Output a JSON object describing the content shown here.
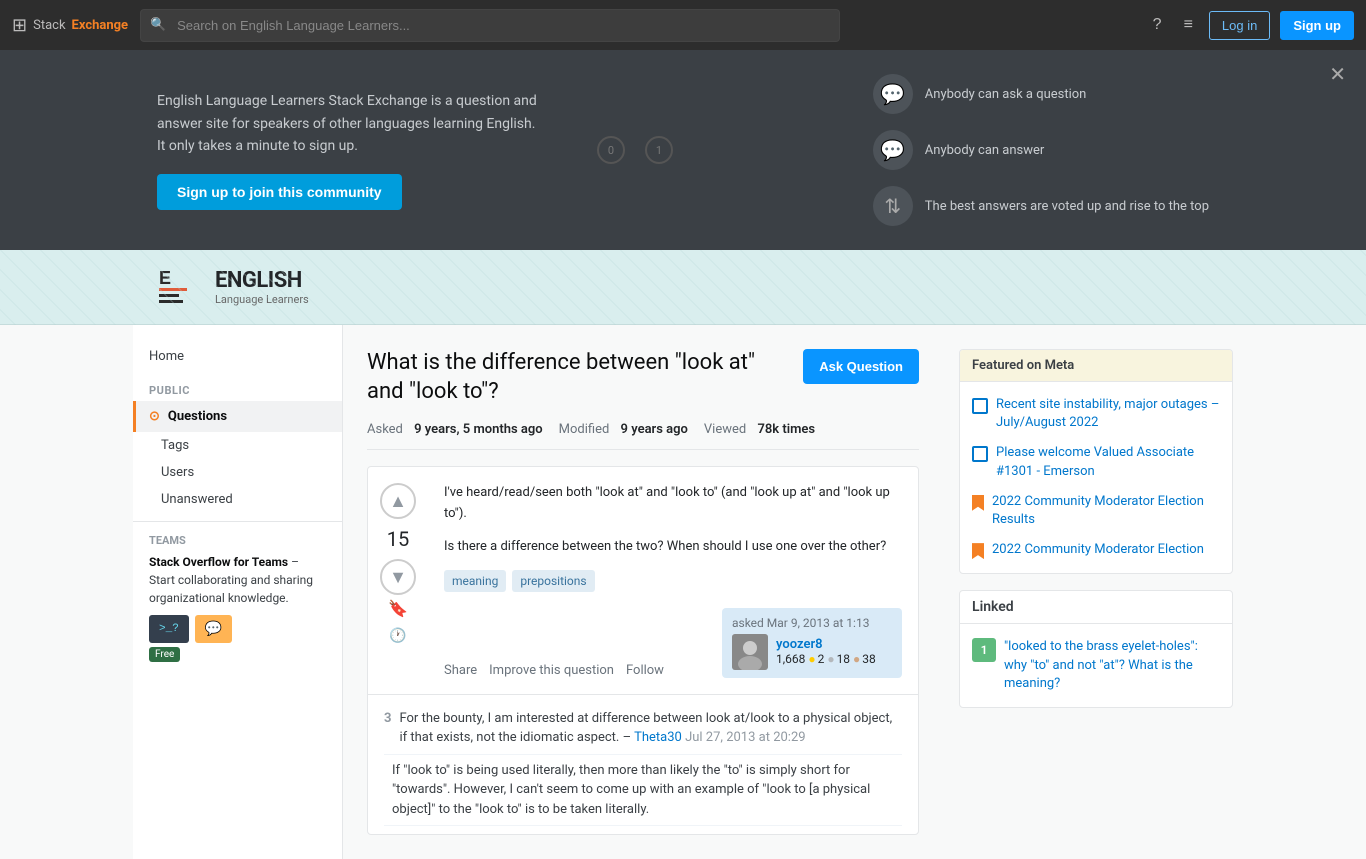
{
  "topbar": {
    "logo": "Stack Exchange",
    "logo_stack": "Stack",
    "logo_exchange": "Exchange",
    "search_placeholder": "Search on English Language Learners...",
    "login_label": "Log in",
    "signup_label": "Sign up"
  },
  "hero": {
    "description": "English Language Learners Stack Exchange is a question and answer site for speakers of other languages learning English. It only takes a minute to sign up.",
    "cta_label": "Sign up to join this community",
    "close_title": "Close",
    "features": [
      {
        "icon": "💬",
        "text": "Anybody can ask a question"
      },
      {
        "icon": "💬",
        "text": "Anybody can answer"
      },
      {
        "icon": "▲▼",
        "text": "The best answers are voted up and rise to the top"
      }
    ]
  },
  "site_logo": {
    "name": "ENGLISH",
    "sub": "Language Learners"
  },
  "sidebar": {
    "home_label": "Home",
    "public_label": "PUBLIC",
    "questions_label": "Questions",
    "tags_label": "Tags",
    "users_label": "Users",
    "unanswered_label": "Unanswered",
    "teams_label": "TEAMS",
    "teams_heading": "Stack Overflow for Teams",
    "teams_desc": " – Start collaborating and sharing organizational knowledge.",
    "teams_free": "Free"
  },
  "question": {
    "title": "What is the difference between \"look at\" and \"look to\"?",
    "ask_label": "Ask Question",
    "meta": {
      "asked_label": "Asked",
      "asked_value": "9 years, 5 months ago",
      "modified_label": "Modified",
      "modified_value": "9 years ago",
      "viewed_label": "Viewed",
      "viewed_value": "78k times"
    },
    "vote_count": "15",
    "body_line1": "I've heard/read/seen both \"look at\" and \"look to\" (and \"look up at\" and \"look up to\").",
    "body_line2": "Is there a difference between the two? When should I use one over the other?",
    "tags": [
      "meaning",
      "prepositions"
    ],
    "actions": {
      "share": "Share",
      "improve": "Improve this question",
      "follow": "Follow"
    },
    "user": {
      "asked_label": "asked Mar 9, 2013 at 1:13",
      "name": "yoozer8",
      "rep": "1,668",
      "badge_gold": "2",
      "badge_silver": "18",
      "badge_bronze": "38"
    },
    "comment": {
      "vote": "3",
      "text": "For the bounty, I am interested at difference between look at/look to a physical object, if that exists, not the idiomatic aspect. –",
      "user": "Theta30",
      "time": "Jul 27, 2013 at 20:29"
    },
    "comment2": {
      "text": "If \"look to\" is being used literally, then more than likely the \"to\" is simply short for \"towards\". However, I can't seem to come up with an example of \"look to [a physical object]\" to the \"look to\" is to be taken literally."
    }
  },
  "right_sidebar": {
    "featured_header": "Featured on Meta",
    "featured_items": [
      {
        "type": "square",
        "text": "Recent site instability, major outages – July/August 2022"
      },
      {
        "type": "square",
        "text": "Please welcome Valued Associate #1301 - Emerson"
      },
      {
        "type": "bookmark",
        "text": "2022 Community Moderator Election Results"
      },
      {
        "type": "bookmark",
        "text": "2022 Community Moderator Election"
      }
    ],
    "linked_header": "Linked",
    "linked_items": [
      {
        "count": "1",
        "positive": true,
        "text": "\"looked to the brass eyelet-holes\": why \"to\" and not \"at\"? What is the meaning?"
      }
    ]
  }
}
